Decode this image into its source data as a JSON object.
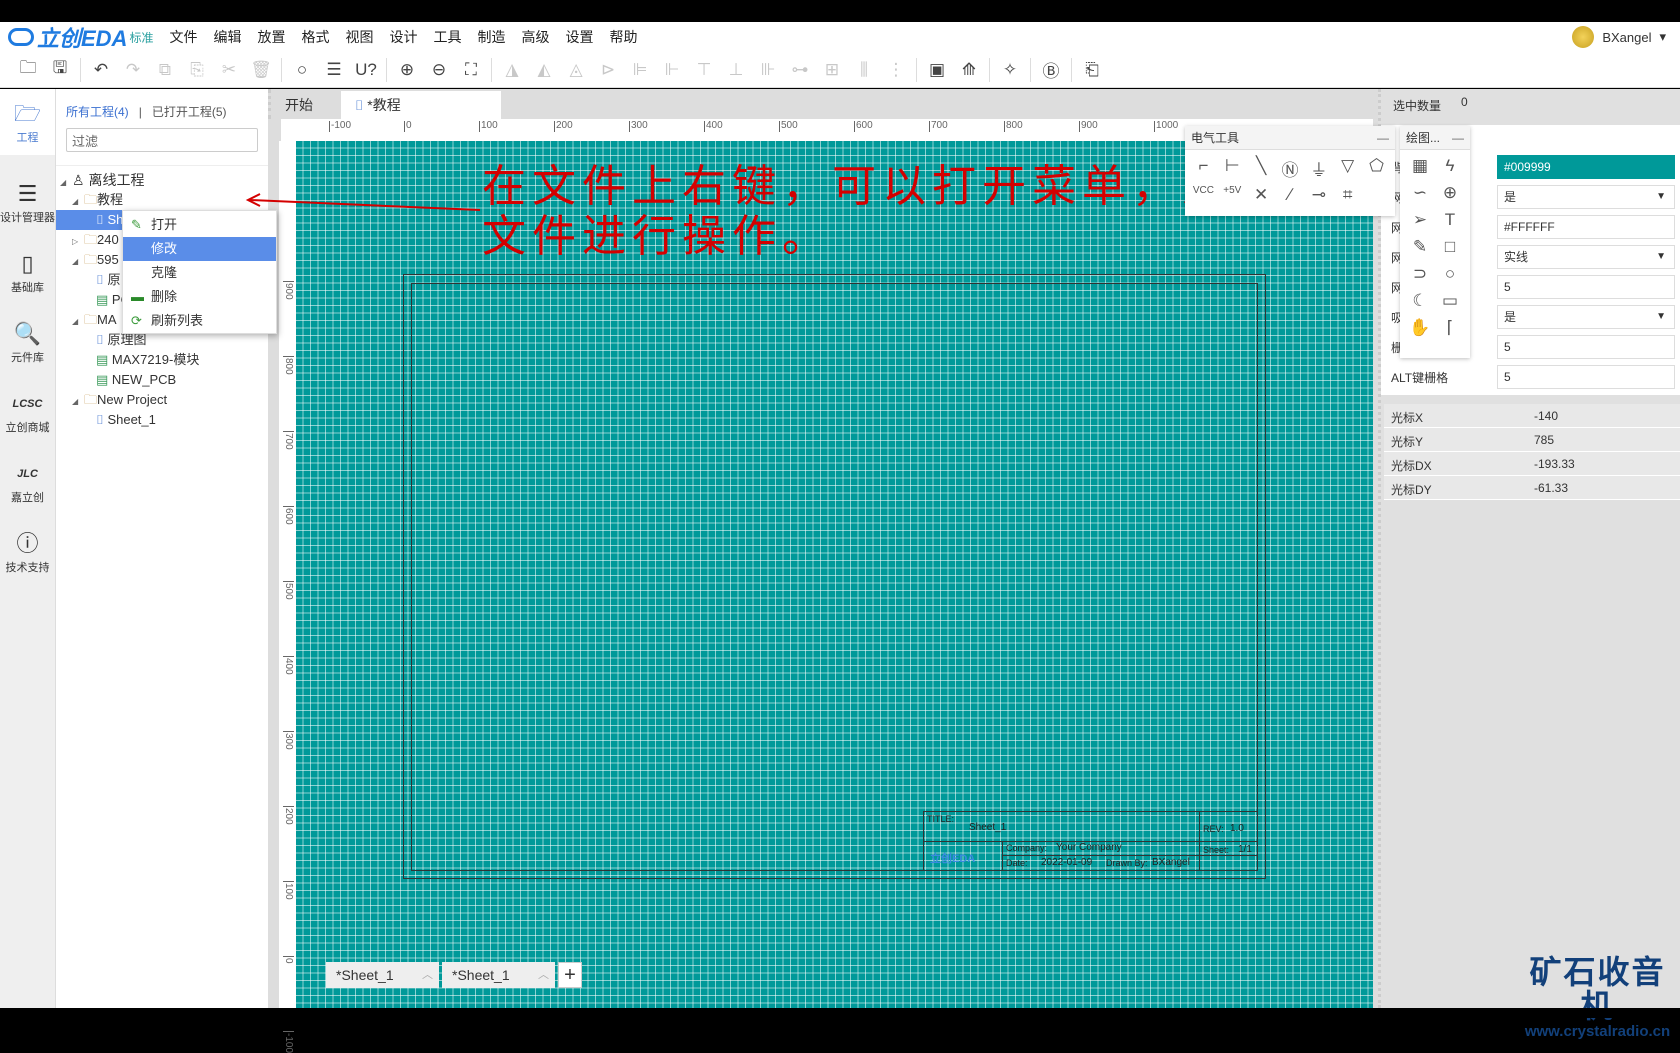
{
  "app": {
    "logo": "立创EDA",
    "edition": "标准",
    "user": "BXangel"
  },
  "menu": [
    "文件",
    "编辑",
    "放置",
    "格式",
    "视图",
    "设计",
    "工具",
    "制造",
    "高级",
    "设置",
    "帮助"
  ],
  "rail": [
    {
      "label": "工程",
      "icon": "folder-icon"
    },
    {
      "label": "设计管理器",
      "icon": "design-manager-icon"
    },
    {
      "label": "基础库",
      "icon": "chip-icon"
    },
    {
      "label": "元件库",
      "icon": "component-search-icon"
    },
    {
      "label": "立创商城",
      "icon": "lcsc-icon"
    },
    {
      "label": "嘉立创",
      "icon": "jlc-icon"
    },
    {
      "label": "技术支持",
      "icon": "help-icon"
    }
  ],
  "project_panel": {
    "tab_all": "所有工程(4)",
    "separator": "|",
    "tab_open": "已打开工程(5)",
    "filter_placeholder": "过滤",
    "tree": {
      "root": "离线工程",
      "n1": "教程",
      "n1a": "Sh",
      "n2": "240",
      "n3": "595",
      "n3a": "原",
      "n3b": "PC",
      "n4": "MA",
      "n4a": "原理图",
      "n4b": "MAX7219-模块",
      "n4c": "NEW_PCB",
      "n5": "New Project",
      "n5a": "Sheet_1"
    }
  },
  "context_menu": [
    {
      "label": "打开",
      "icon": "pencil-icon"
    },
    {
      "label": "修改",
      "icon": ""
    },
    {
      "label": "克隆",
      "icon": ""
    },
    {
      "label": "删除",
      "icon": "delete-icon"
    },
    {
      "label": "刷新列表",
      "icon": "refresh-icon"
    }
  ],
  "doc_tabs": {
    "start": "开始",
    "active": "*教程"
  },
  "ruler": {
    "x": [
      "-100",
      "0",
      "100",
      "200",
      "300",
      "400",
      "500",
      "600",
      "700",
      "800",
      "900",
      "1000"
    ],
    "y": [
      "900",
      "800",
      "700",
      "600",
      "500",
      "400",
      "300",
      "200",
      "100",
      "0",
      "-100"
    ]
  },
  "annotation": {
    "line1": "在文件上右键，可以打开菜单，对",
    "line2": "文件进行操作。",
    "color": "#d40000"
  },
  "title_block": {
    "title_label": "TITLE:",
    "title": "Sheet_1",
    "rev_label": "REV:",
    "rev": "1.0",
    "company_label": "Company:",
    "company": "Your Company",
    "sheet_label": "Sheet:",
    "sheet": "1/1",
    "date_label": "Date:",
    "date": "2022-01-09",
    "drawn_label": "Drawn By:",
    "drawn": "BXangel",
    "logo": "立创EDA"
  },
  "electrical_tools": {
    "title": "电气工具",
    "minimize": "—"
  },
  "drawing_tools": {
    "title": "绘图...",
    "minimize": "—"
  },
  "properties": {
    "selected_label": "选中数量",
    "selected": "0",
    "rows": [
      {
        "label": "背景色",
        "value": "#009999"
      },
      {
        "label": "网格可见",
        "value": "是",
        "select": true
      },
      {
        "label": "网格颜色",
        "value": "#FFFFFF"
      },
      {
        "label": "网格样式",
        "value": "实线",
        "select": true
      },
      {
        "label": "网格大小",
        "value": "5"
      },
      {
        "label": "吸附",
        "value": "是",
        "select": true
      },
      {
        "label": "栅格尺寸",
        "value": "5"
      },
      {
        "label": "ALT键栅格",
        "value": "5"
      }
    ],
    "cursor": [
      {
        "label": "光标X",
        "value": "-140"
      },
      {
        "label": "光标Y",
        "value": "785"
      },
      {
        "label": "光标DX",
        "value": "-193.33"
      },
      {
        "label": "光标DY",
        "value": "-61.33"
      }
    ]
  },
  "sheet_tabs": [
    "*Sheet_1",
    "*Sheet_1"
  ],
  "add_tab": "+",
  "watermark": {
    "name": "矿石收音机",
    "url": "www.crystalradio.cn"
  },
  "colors": {
    "canvas": "#009999",
    "grid": "#FFFFFF",
    "accent": "#5a8de8"
  }
}
